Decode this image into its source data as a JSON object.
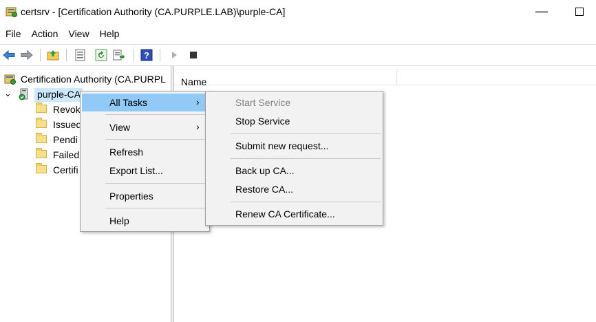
{
  "window": {
    "title": "certsrv - [Certification Authority (CA.PURPLE.LAB)\\purple-CA]",
    "minimize_glyph": "—"
  },
  "menubar": [
    "File",
    "Action",
    "View",
    "Help"
  ],
  "toolbar": {
    "icons": [
      "back-arrow-icon",
      "forward-arrow-icon",
      "up-folder-icon",
      "properties-icon",
      "refresh-icon",
      "export-list-icon",
      "help-icon",
      "start-service-icon",
      "stop-service-icon"
    ]
  },
  "tree": {
    "root": "Certification Authority (CA.PURPL",
    "ca": "purple-CA",
    "folders": [
      "Revok",
      "Issued",
      "Pendi",
      "Failed",
      "Certifi"
    ]
  },
  "list": {
    "column_name": "Name"
  },
  "context_menu": {
    "items": [
      "All Tasks",
      "View",
      "Refresh",
      "Export List...",
      "Properties",
      "Help"
    ],
    "submenu_arrow": "›"
  },
  "submenu": {
    "start_service": "Start Service",
    "stop_service": "Stop Service",
    "submit_request": "Submit new request...",
    "backup_ca": "Back up CA...",
    "restore_ca": "Restore CA...",
    "renew_ca": "Renew CA Certificate..."
  },
  "colors": {
    "highlight": "#91c9f7",
    "selection": "#cce8ff",
    "menu_bg": "#f2f2f2",
    "disabled_text": "#808080"
  }
}
